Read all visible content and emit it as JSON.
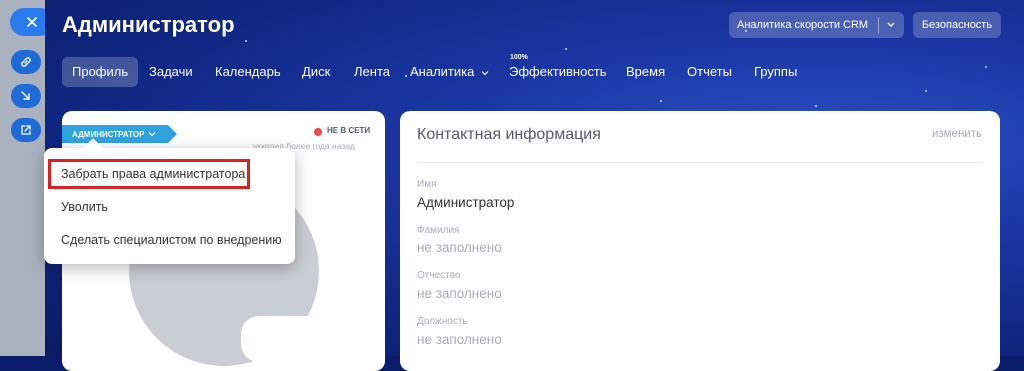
{
  "side": {
    "close_icon": "close-icon",
    "link_icon": "link-icon",
    "collapse_icon": "arrow-down-right-icon",
    "external_icon": "open-external-icon"
  },
  "header": {
    "title": "Администратор",
    "crm_button": "Аналитика скорости CRM",
    "security_button": "Безопасность"
  },
  "nav": {
    "tabs": [
      "Профиль",
      "Задачи",
      "Календарь",
      "Диск",
      "Лента",
      "Аналитика",
      "Эффективность",
      "Время",
      "Отчеты",
      "Группы"
    ],
    "active_tab": "Профиль",
    "efficiency_badge": "100%"
  },
  "profile": {
    "role": "АДМИНИСТРАТОР",
    "status": "НЕ В СЕТИ",
    "last_seen": "заходил более года назад",
    "status_color": "#f0474b",
    "role_color": "#2fa3e0"
  },
  "role_menu": {
    "items": [
      "Забрать права администратора",
      "Уволить",
      "Сделать специалистом по внедрению"
    ],
    "highlighted_item": "Забрать права администратора",
    "highlight_color": "#e02020"
  },
  "contact": {
    "title": "Контактная информация",
    "edit": "изменить",
    "fields": [
      {
        "label": "Имя",
        "value": "Администратор"
      },
      {
        "label": "Фамилия",
        "value": "не заполнено"
      },
      {
        "label": "Отчество",
        "value": "не заполнено"
      },
      {
        "label": "Должность",
        "value": "не заполнено"
      }
    ]
  }
}
